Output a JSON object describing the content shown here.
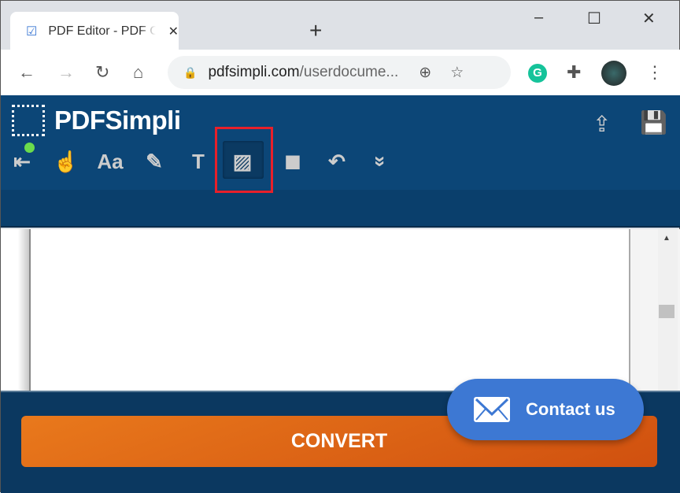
{
  "browser": {
    "tab_title": "PDF Editor - PDF Conversion Made Easy",
    "tab_close": "✕",
    "new_tab": "+",
    "minimize": "–",
    "maximize": "☐",
    "close": "✕",
    "url_domain": "pdfsimpli.com",
    "url_path": "/userdocume...",
    "back": "←",
    "forward": "→",
    "reload": "↻",
    "home": "⌂",
    "zoom": "⊕",
    "star": "☆",
    "grammarly": "G",
    "extensions": "✚",
    "menu": "⋮"
  },
  "app": {
    "logo": "PDFSimpli",
    "accent": "#0c4677",
    "tools": [
      {
        "name": "exit",
        "glyph": "⇤"
      },
      {
        "name": "hand",
        "glyph": "☝"
      },
      {
        "name": "text",
        "glyph": "Aa"
      },
      {
        "name": "edit",
        "glyph": "✎"
      },
      {
        "name": "textbox",
        "glyph": "T"
      },
      {
        "name": "image",
        "glyph": "▨",
        "active": true
      },
      {
        "name": "shape",
        "glyph": "■"
      },
      {
        "name": "undo",
        "glyph": "↶"
      },
      {
        "name": "more",
        "glyph": "»"
      }
    ],
    "share": "⇪",
    "save": "💾",
    "convert_label": "CONVERT",
    "contact_label": "Contact us",
    "convert_color": "#e07018",
    "contact_color": "#3d78d3"
  }
}
